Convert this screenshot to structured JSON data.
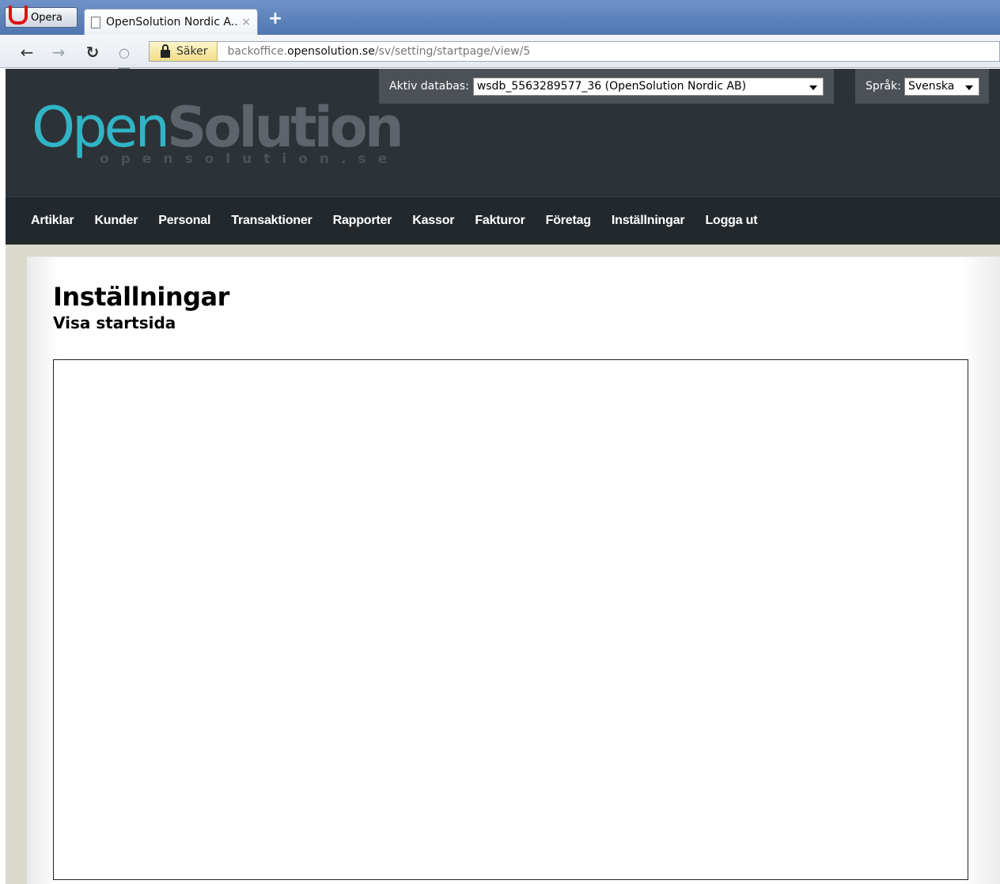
{
  "browser": {
    "menu_label": "Opera",
    "tab_title": "OpenSolution Nordic A...",
    "tab_close": "×",
    "new_tab": "+",
    "secure_label": "Säker",
    "url_prefix": "backoffice.",
    "url_domain": "opensolution.se",
    "url_path": "/sv/setting/startpage/view/5"
  },
  "header": {
    "logo_open": "Open",
    "logo_solution": "Solution",
    "logo_tagline": "opensolution.se",
    "db_label": "Aktiv databas:",
    "db_value": "wsdb_5563289577_36 (OpenSolution Nordic AB)",
    "lang_label": "Språk:",
    "lang_value": "Svenska"
  },
  "nav": {
    "items": [
      "Artiklar",
      "Kunder",
      "Personal",
      "Transaktioner",
      "Rapporter",
      "Kassor",
      "Fakturor",
      "Företag",
      "Inställningar",
      "Logga ut"
    ]
  },
  "main": {
    "title": "Inställningar",
    "subtitle": "Visa startsida"
  }
}
